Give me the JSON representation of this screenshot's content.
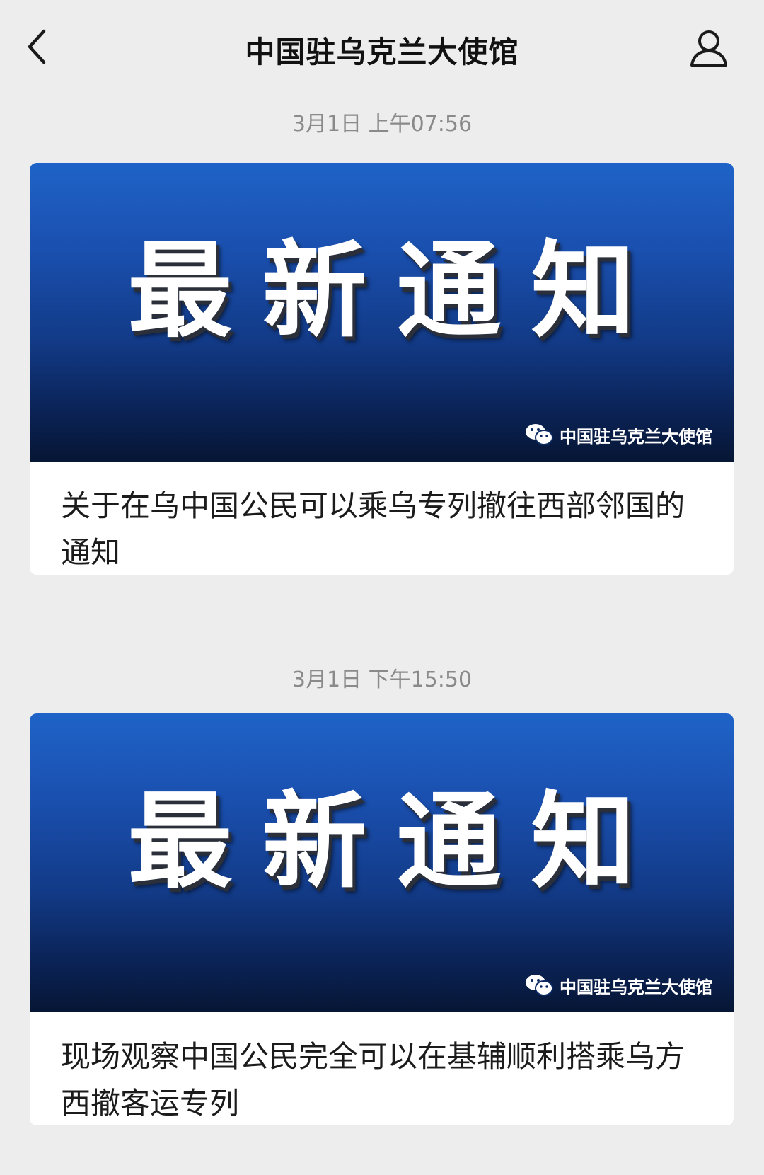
{
  "header": {
    "title": "中国驻乌克兰大使馆",
    "back_icon": "chevron-left-icon",
    "profile_icon": "person-icon"
  },
  "messages": [
    {
      "timestamp": "3月1日 上午07:56",
      "banner_text": "最新通知",
      "watermark": "中国驻乌克兰大使馆",
      "title": "关于在乌中国公民可以乘乌专列撤往西部邻国的通知"
    },
    {
      "timestamp": "3月1日 下午15:50",
      "banner_text": "最新通知",
      "watermark": "中国驻乌克兰大使馆",
      "title": "现场观察中国公民完全可以在基辅顺利搭乘乌方西撤客运专列"
    }
  ],
  "colors": {
    "background": "#ededed",
    "banner_top": "#1f63c8",
    "banner_bottom": "#061634",
    "timestamp": "#8a8a8a"
  }
}
